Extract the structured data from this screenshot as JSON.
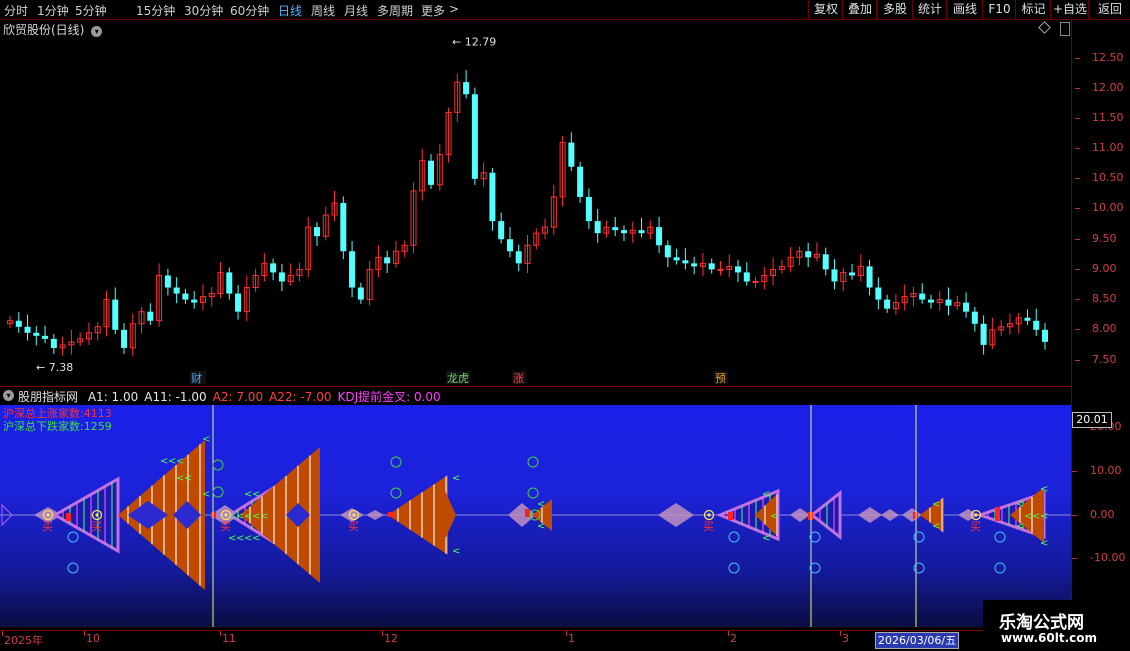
{
  "toolbar": {
    "periods": [
      "分时",
      "1分钟",
      "5分钟",
      "15分钟",
      "30分钟",
      "60分钟",
      "日线",
      "周线",
      "月线",
      "多周期",
      "更多"
    ],
    "active_period": "日线",
    "more_arrow": ">",
    "buttons": [
      "复权",
      "叠加",
      "多股",
      "统计",
      "画线",
      "F10",
      "标记",
      "+自选",
      "返回"
    ]
  },
  "main_chart": {
    "title": "欣贸股份(日线)",
    "high_label": "12.79",
    "low_label": "7.38",
    "price_axis": [
      "12.50",
      "12.00",
      "11.50",
      "11.00",
      "10.50",
      "10.00",
      "9.50",
      "9.00",
      "8.50",
      "8.00",
      "7.50"
    ],
    "markers": [
      {
        "text": "财",
        "color": "#4aa8ff"
      },
      {
        "text": "龙虎",
        "color": "#6bd36b"
      },
      {
        "text": "涨",
        "color": "#ff4040"
      },
      {
        "text": "预",
        "color": "#e0a030"
      }
    ],
    "colors": {
      "up": "#ff3030",
      "down": "#54ffff"
    }
  },
  "chart_data": {
    "type": "candlestick",
    "ylim": [
      7.2,
      12.9
    ],
    "high": 12.79,
    "low": 7.38,
    "closes": [
      8.15,
      8.05,
      7.95,
      7.9,
      7.85,
      7.7,
      7.75,
      7.8,
      7.85,
      7.95,
      8.05,
      8.5,
      8.0,
      7.7,
      8.1,
      8.3,
      8.15,
      8.9,
      8.7,
      8.6,
      8.5,
      8.45,
      8.55,
      8.6,
      8.95,
      8.6,
      8.3,
      8.7,
      8.9,
      9.1,
      8.95,
      8.8,
      8.9,
      9.0,
      9.7,
      9.55,
      9.9,
      10.1,
      9.3,
      8.7,
      8.5,
      9.0,
      9.2,
      9.1,
      9.3,
      9.4,
      10.3,
      10.8,
      10.4,
      10.9,
      11.6,
      12.1,
      11.9,
      10.5,
      10.6,
      9.8,
      9.5,
      9.3,
      9.1,
      9.4,
      9.6,
      9.7,
      10.2,
      11.1,
      10.7,
      10.2,
      9.8,
      9.6,
      9.7,
      9.65,
      9.6,
      9.65,
      9.6,
      9.7,
      9.4,
      9.2,
      9.15,
      9.1,
      9.05,
      9.1,
      9.0,
      9.0,
      9.05,
      8.95,
      8.8,
      8.8,
      8.9,
      9.0,
      9.05,
      9.2,
      9.3,
      9.2,
      9.25,
      9.0,
      8.8,
      8.95,
      8.9,
      9.05,
      8.7,
      8.5,
      8.35,
      8.45,
      8.55,
      8.6,
      8.5,
      8.45,
      8.5,
      8.4,
      8.45,
      8.3,
      8.1,
      7.75,
      8.0,
      8.05,
      8.1,
      8.2,
      8.15,
      8.0,
      7.8
    ]
  },
  "lower_panel": {
    "title": "股朋指标网",
    "params": [
      {
        "text": "A1: 1.00",
        "color": "#e6e6e6"
      },
      {
        "text": "A11: -1.00",
        "color": "#e6e6e6"
      },
      {
        "text": "A2: 7.00",
        "color": "#ff4040"
      },
      {
        "text": "A22: -7.00",
        "color": "#ff4040"
      },
      {
        "text": "KDJ提前金叉: 0.00",
        "color": "#ff40ff"
      }
    ],
    "stat_up": "沪深总上涨家数:4113",
    "stat_down": "沪深总下跌家数:1259",
    "current_value": "20.01",
    "axis": [
      "20.00",
      "10.00",
      "0.00",
      "-10.00"
    ],
    "buy_label": "买"
  },
  "date_axis": {
    "labels": [
      "2025年",
      "10",
      "11",
      "12",
      "1",
      "2",
      "3"
    ],
    "current_date": "2026/03/06/五"
  },
  "watermark": {
    "title": "乐淘公式网",
    "url": "www.60lt.com"
  }
}
